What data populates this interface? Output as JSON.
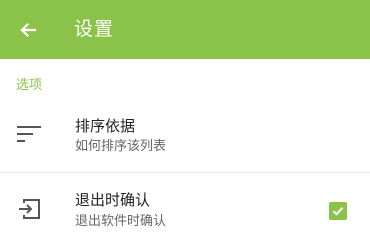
{
  "app_bar": {
    "title": "设置",
    "back_icon": "arrow-back-icon",
    "color": "#8bc34a"
  },
  "sections": [
    {
      "header": "选项",
      "items": [
        {
          "title": "排序依据",
          "summary": "如何排序该列表",
          "icon": "sort-icon"
        },
        {
          "title": "退出时确认",
          "summary": "退出软件时确认",
          "icon": "exit-icon",
          "checked": true
        }
      ]
    }
  ]
}
